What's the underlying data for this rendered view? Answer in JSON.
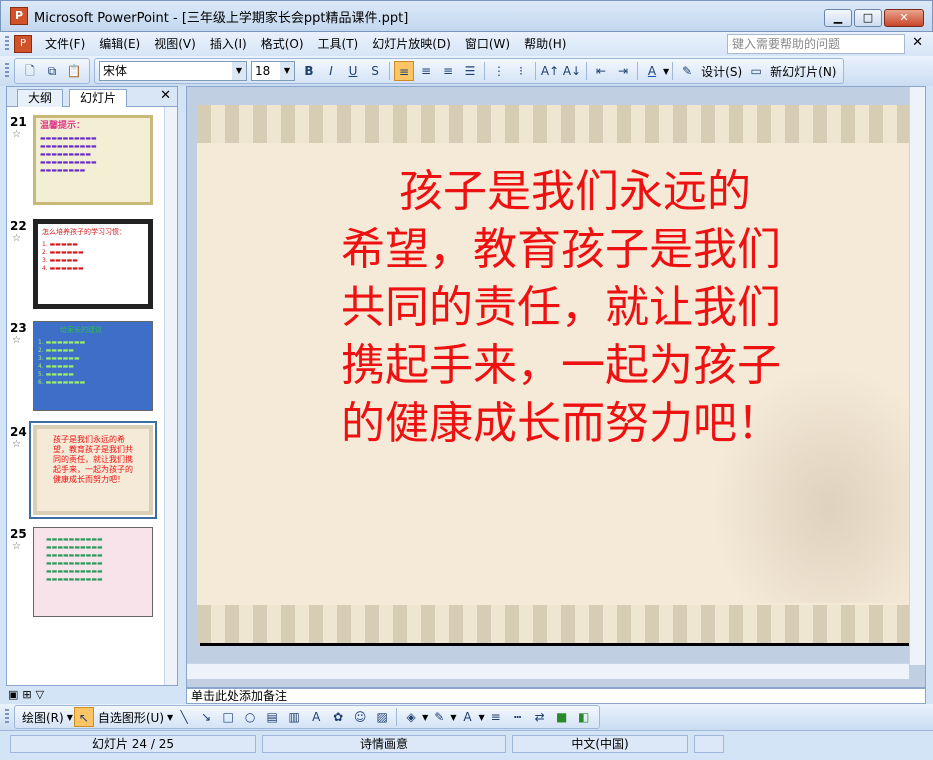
{
  "window": {
    "title": "Microsoft PowerPoint - [三年级上学期家长会ppt精品课件.ppt]",
    "app_icon": "powerpoint-icon"
  },
  "menu": {
    "items": [
      "文件(F)",
      "编辑(E)",
      "视图(V)",
      "插入(I)",
      "格式(O)",
      "工具(T)",
      "幻灯片放映(D)",
      "窗口(W)",
      "帮助(H)"
    ],
    "help_placeholder": "键入需要帮助的问题"
  },
  "toolbar": {
    "font_name": "宋体",
    "font_size": "18",
    "bold": "B",
    "italic": "I",
    "underline": "U",
    "shadow": "S",
    "design_label": "设计(S)",
    "new_slide_label": "新幻灯片(N)"
  },
  "left_pane": {
    "tabs": [
      "大纲",
      "幻灯片"
    ],
    "thumbnails": [
      {
        "num": "21",
        "title": "温馨提示：",
        "bg": "#f3efd4"
      },
      {
        "num": "22",
        "title": "怎么培养孩子的学习习惯：",
        "bg": "#ffffff"
      },
      {
        "num": "23",
        "title": "给家长的建议",
        "bg": "#3d6fc9"
      },
      {
        "num": "24",
        "text": "孩子是我们永远的希望，教育孩子是我们共同的责任，就让我们携起手来，一起为孩子的健康成长而努力吧！",
        "bg": "#f5ead7"
      },
      {
        "num": "25",
        "bg": "#f9e3ea"
      }
    ]
  },
  "slide": {
    "text": "孩子是我们永远的希望，教育孩子是我们共同的责任，就让我们携起手来，一起为孩子的健康成长而努力吧！",
    "text_color": "#ee1111"
  },
  "notes": {
    "placeholder": "单击此处添加备注"
  },
  "drawbar": {
    "draw_label": "绘图(R)",
    "autoshape_label": "自选图形(U)"
  },
  "status": {
    "slide": "幻灯片 24 / 25",
    "design": "诗情画意",
    "language": "中文(中国)"
  }
}
